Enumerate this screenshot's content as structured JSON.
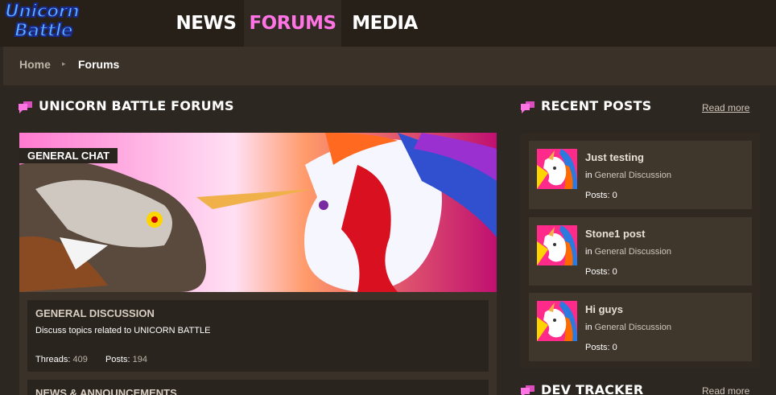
{
  "logo": {
    "line1": "Unicorn",
    "line2": "Battle"
  },
  "nav": {
    "items": [
      {
        "label": "NEWS"
      },
      {
        "label": "FORUMS"
      },
      {
        "label": "MEDIA"
      }
    ],
    "active": "FORUMS"
  },
  "breadcrumb": {
    "home": "Home",
    "separator": "▸",
    "current": "Forums"
  },
  "forums_section": {
    "title": "UNICORN BATTLE FORUMS",
    "banner_label": "GENERAL CHAT",
    "forums": [
      {
        "title": "GENERAL DISCUSSION",
        "description": "Discuss topics related to UNICORN BATTLE",
        "threads_label": "Threads:",
        "threads": "409",
        "posts_label": "Posts:",
        "posts": "194"
      },
      {
        "title": "NEWS & ANNOUNCEMENTS"
      }
    ]
  },
  "recent_posts": {
    "title": "RECENT POSTS",
    "read_more": "Read more",
    "posts": [
      {
        "title": "Just testing",
        "in_prefix": "in",
        "where": "General Discussion",
        "posts_label": "Posts:",
        "posts": "0"
      },
      {
        "title": "Stone1 post",
        "in_prefix": "in",
        "where": "General Discussion",
        "posts_label": "Posts:",
        "posts": "0"
      },
      {
        "title": "Hi guys",
        "in_prefix": "in",
        "where": "General Discussion",
        "posts_label": "Posts:",
        "posts": "0"
      }
    ]
  },
  "dev_tracker": {
    "title": "DEV TRACKER",
    "read_more": "Read more"
  },
  "colors": {
    "accent_pink": "#ff74e4",
    "background": "#2d2721",
    "panel": "#3a3229"
  },
  "icons": {
    "section_icon": "chat-bubbles-icon"
  }
}
